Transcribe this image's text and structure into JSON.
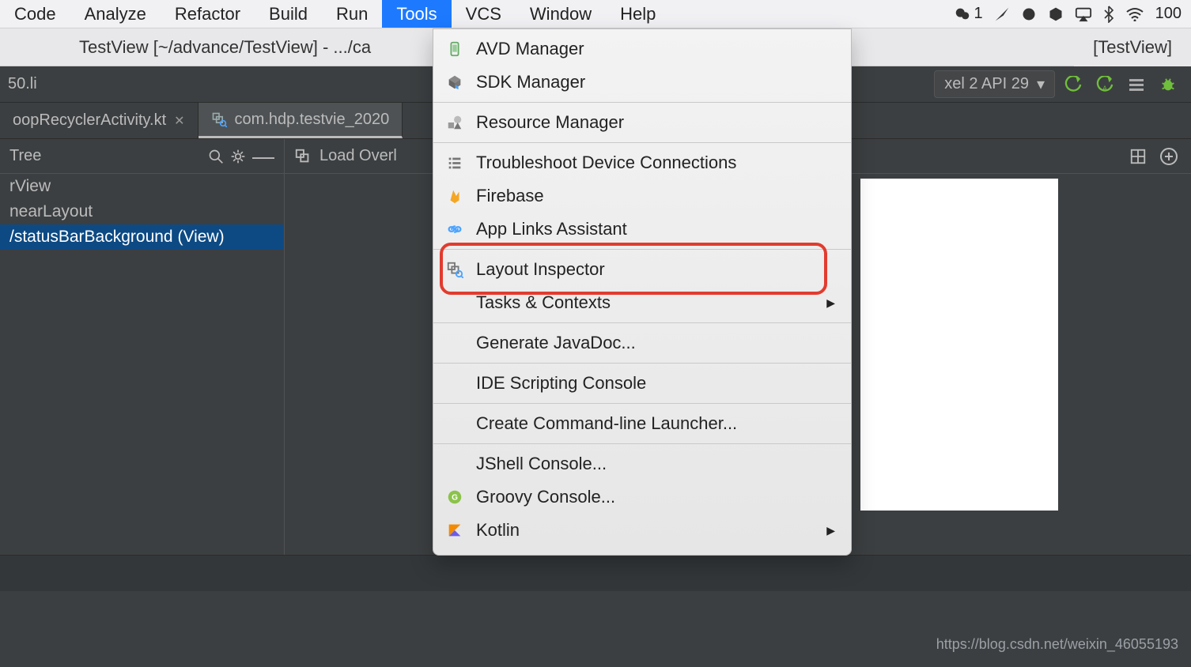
{
  "menubar": {
    "items": [
      "Code",
      "Analyze",
      "Refactor",
      "Build",
      "Run",
      "Tools",
      "VCS",
      "Window",
      "Help"
    ],
    "selected": "Tools",
    "status_badge_count": "1",
    "status_battery": "100"
  },
  "window": {
    "title_left": "TestView [~/advance/TestView] - .../ca",
    "title_right": "[TestView]"
  },
  "idebar": {
    "breadcrumb": "50.li",
    "device": "xel 2 API 29"
  },
  "tabs": [
    {
      "label": "oopRecyclerActivity.kt",
      "closable": true
    },
    {
      "label": "com.hdp.testvie_2020",
      "closable": false,
      "active": true,
      "hasIcon": true
    }
  ],
  "panel": {
    "left_title": "Tree",
    "mid_label": "Load Overl"
  },
  "tree": {
    "nodes": [
      {
        "label": "rView",
        "sel": false
      },
      {
        "label": "nearLayout",
        "sel": false
      },
      {
        "label": "/statusBarBackground (View)",
        "sel": true
      }
    ]
  },
  "menu": {
    "groups": [
      [
        {
          "label": "AVD Manager",
          "icon": "device-icon"
        },
        {
          "label": "SDK Manager",
          "icon": "cube-icon"
        }
      ],
      [
        {
          "label": "Resource Manager",
          "icon": "shapes-icon"
        }
      ],
      [
        {
          "label": "Troubleshoot Device Connections",
          "icon": "list-icon"
        },
        {
          "label": "Firebase",
          "icon": "firebase-icon"
        },
        {
          "label": "App Links Assistant",
          "icon": "link-icon"
        }
      ],
      [
        {
          "label": "Layout Inspector",
          "icon": "layout-inspector-icon",
          "highlighted": true
        },
        {
          "label": "Tasks & Contexts",
          "submenu": true
        }
      ],
      [
        {
          "label": "Generate JavaDoc..."
        }
      ],
      [
        {
          "label": "IDE Scripting Console"
        }
      ],
      [
        {
          "label": "Create Command-line Launcher..."
        }
      ],
      [
        {
          "label": "JShell Console..."
        },
        {
          "label": "Groovy Console...",
          "icon": "groovy-icon"
        },
        {
          "label": "Kotlin",
          "icon": "kotlin-icon",
          "submenu": true
        }
      ]
    ]
  },
  "watermark": "https://blog.csdn.net/weixin_46055193"
}
